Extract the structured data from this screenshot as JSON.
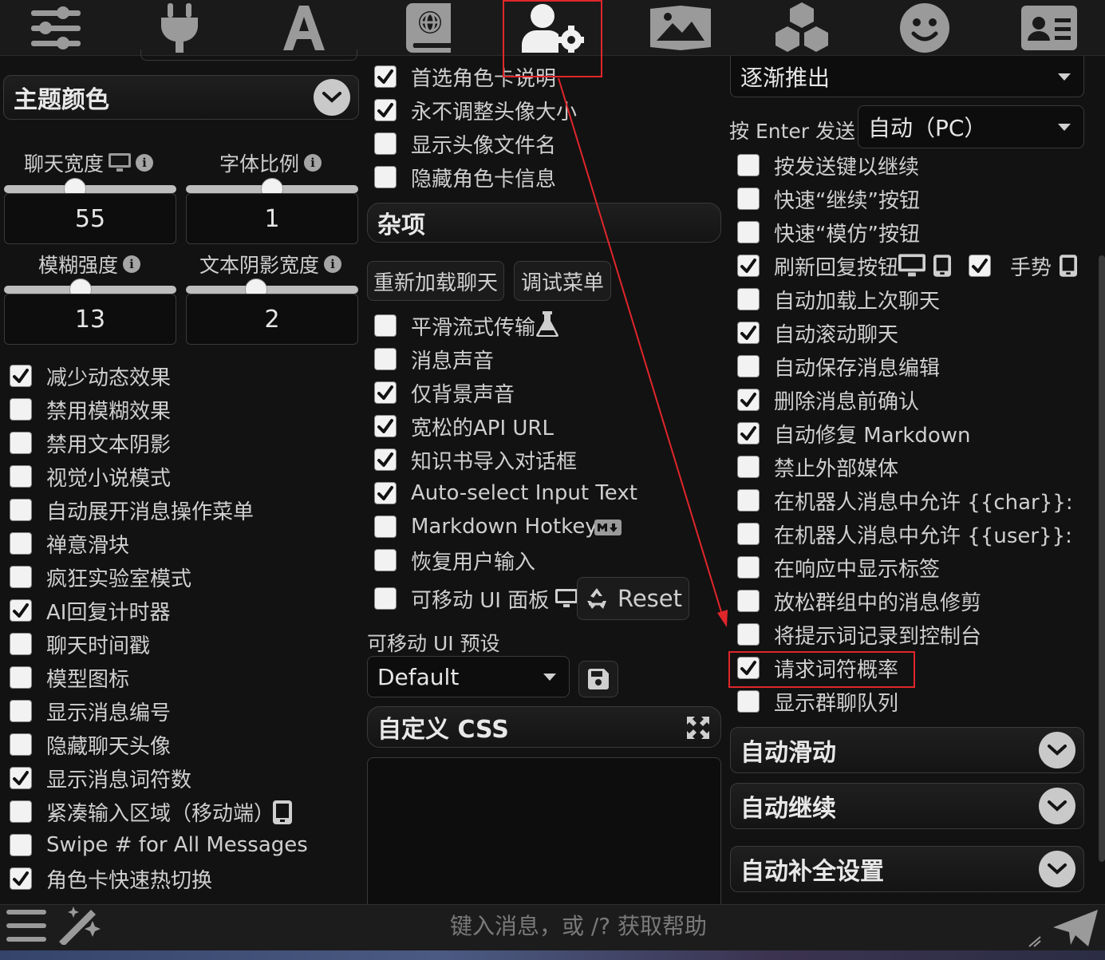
{
  "topbar": {
    "icons": [
      "sliders-icon",
      "plug-icon",
      "font-icon",
      "book-globe-icon",
      "user-gear-icon",
      "image-icon",
      "cubes-icon",
      "smiley-icon",
      "id-card-icon"
    ]
  },
  "left": {
    "theme_drawer": "主题颜色",
    "sliders": [
      {
        "label": "聊天宽度",
        "value": "55",
        "fraction": 0.42
      },
      {
        "label": "字体比例",
        "value": "1",
        "fraction": 0.5
      },
      {
        "label": "模糊强度",
        "value": "13",
        "fraction": 0.44
      },
      {
        "label": "文本阴影宽度",
        "value": "2",
        "fraction": 0.41
      }
    ],
    "checks": [
      {
        "label": "减少动态效果",
        "checked": true
      },
      {
        "label": "禁用模糊效果",
        "checked": false
      },
      {
        "label": "禁用文本阴影",
        "checked": false
      },
      {
        "label": "视觉小说模式",
        "checked": false
      },
      {
        "label": "自动展开消息操作菜单",
        "checked": false
      },
      {
        "label": "禅意滑块",
        "checked": false
      },
      {
        "label": "疯狂实验室模式",
        "checked": false
      },
      {
        "label": "AI回复计时器",
        "checked": true
      },
      {
        "label": "聊天时间戳",
        "checked": false
      },
      {
        "label": "模型图标",
        "checked": false
      },
      {
        "label": "显示消息编号",
        "checked": false
      },
      {
        "label": "隐藏聊天头像",
        "checked": false
      },
      {
        "label": "显示消息词符数",
        "checked": true
      },
      {
        "label": "紧凑输入区域（移动端）",
        "checked": false
      },
      {
        "label": "Swipe # for All Messages",
        "checked": false
      },
      {
        "label": "角色卡快速热切换",
        "checked": true
      }
    ]
  },
  "middle": {
    "checks_top": [
      {
        "label": "首选角色卡说明",
        "checked": true
      },
      {
        "label": "永不调整头像大小",
        "checked": true
      },
      {
        "label": "显示头像文件名",
        "checked": false
      },
      {
        "label": "隐藏角色卡信息",
        "checked": false
      }
    ],
    "misc_header": "杂项",
    "reload_button": "重新加载聊天",
    "debug_button": "调试菜单",
    "checks_misc": [
      {
        "label": "平滑流式传输",
        "checked": false
      },
      {
        "label": "消息声音",
        "checked": false
      },
      {
        "label": "仅背景声音",
        "checked": true
      },
      {
        "label": "宽松的API URL",
        "checked": true
      },
      {
        "label": "知识书导入对话框",
        "checked": true
      },
      {
        "label": "Auto-select Input Text",
        "checked": true
      },
      {
        "label": "Markdown Hotkeys",
        "checked": false
      },
      {
        "label": "恢复用户输入",
        "checked": false
      }
    ],
    "movable_ui": {
      "label": "可移动 UI 面板",
      "checked": false
    },
    "reset_button": "Reset",
    "preset_label": "可移动 UI 预设",
    "preset_value": "Default",
    "custom_css_header": "自定义 CSS"
  },
  "right": {
    "top_select": "逐渐推出",
    "enter_label": "按 Enter 发送",
    "enter_value": "自动（PC）",
    "checks": [
      {
        "label": "按发送键以继续",
        "checked": false
      },
      {
        "label": "快速“继续”按钮",
        "checked": false
      },
      {
        "label": "快速“模仿”按钮",
        "checked": false
      },
      {
        "label": "刷新回复按钮",
        "checked": true
      },
      {
        "label": "自动加载上次聊天",
        "checked": false
      },
      {
        "label": "自动滚动聊天",
        "checked": true
      },
      {
        "label": "自动保存消息编辑",
        "checked": false
      },
      {
        "label": "删除消息前确认",
        "checked": true
      },
      {
        "label": "自动修复 Markdown",
        "checked": true
      },
      {
        "label": "禁止外部媒体",
        "checked": false
      },
      {
        "label": "在机器人消息中允许 {{char}}:",
        "checked": false
      },
      {
        "label": "在机器人消息中允许 {{user}}:",
        "checked": false
      },
      {
        "label": "在响应中显示标签",
        "checked": false
      },
      {
        "label": "放松群组中的消息修剪",
        "checked": false
      },
      {
        "label": "将提示词记录到控制台",
        "checked": false
      },
      {
        "label": "请求词符概率",
        "checked": true
      },
      {
        "label": "显示群聊队列",
        "checked": false
      }
    ],
    "gesture": {
      "label": "手势",
      "checked": true
    },
    "drawers": [
      "自动滑动",
      "自动继续",
      "自动补全设置"
    ]
  },
  "bottom": {
    "placeholder": "键入消息，或 /? 获取帮助"
  },
  "colors": {
    "highlight": "#e0262b",
    "panel": "#121212"
  }
}
